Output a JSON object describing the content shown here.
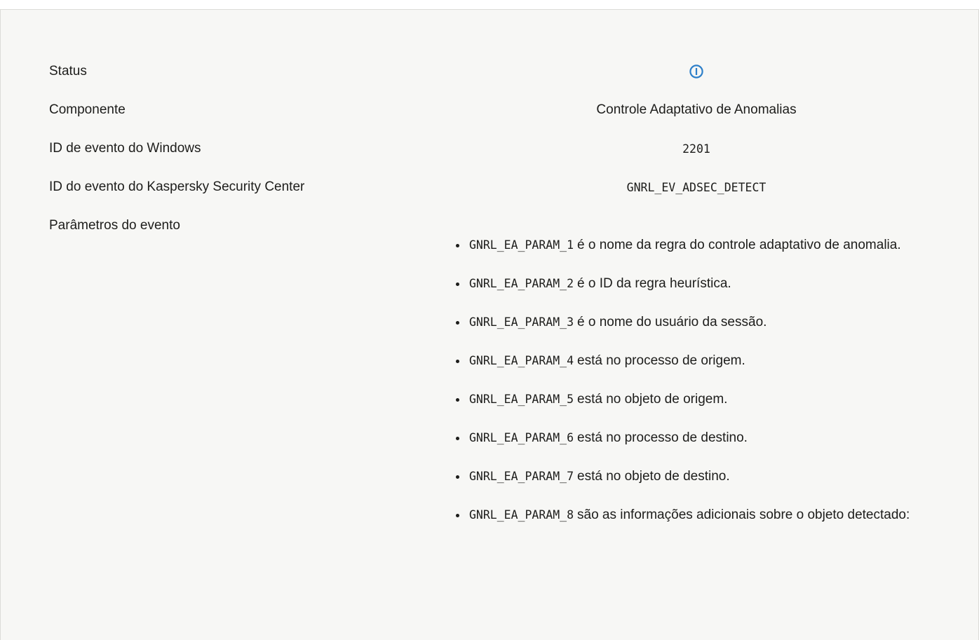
{
  "rows": {
    "status": {
      "label": "Status",
      "icon": "info-icon"
    },
    "component": {
      "label": "Componente",
      "value": "Controle Adaptativo de Anomalias"
    },
    "windows_event_id": {
      "label": "ID de evento do Windows",
      "value": "2201"
    },
    "ksc_event_id": {
      "label": "ID do evento do Kaspersky Security Center",
      "value": "GNRL_EV_ADSEC_DETECT"
    },
    "event_params": {
      "label": "Parâmetros do evento"
    }
  },
  "params": [
    {
      "code": "GNRL_EA_PARAM_1",
      "text": "é o nome da regra do controle adaptativo de anomalia."
    },
    {
      "code": "GNRL_EA_PARAM_2",
      "text": "é o ID da regra heurística."
    },
    {
      "code": "GNRL_EA_PARAM_3",
      "text": "é o nome do usuário da sessão."
    },
    {
      "code": "GNRL_EA_PARAM_4",
      "text": "está no processo de origem."
    },
    {
      "code": "GNRL_EA_PARAM_5",
      "text": "está no objeto de origem."
    },
    {
      "code": "GNRL_EA_PARAM_6",
      "text": "está no processo de destino."
    },
    {
      "code": "GNRL_EA_PARAM_7",
      "text": "está no objeto de destino."
    },
    {
      "code": "GNRL_EA_PARAM_8",
      "text": "são as informações adicionais sobre o objeto detectado:"
    }
  ],
  "colors": {
    "info_icon": "#2d7fc9",
    "panel_bg": "#f7f7f5",
    "border": "#dcdcd8"
  }
}
